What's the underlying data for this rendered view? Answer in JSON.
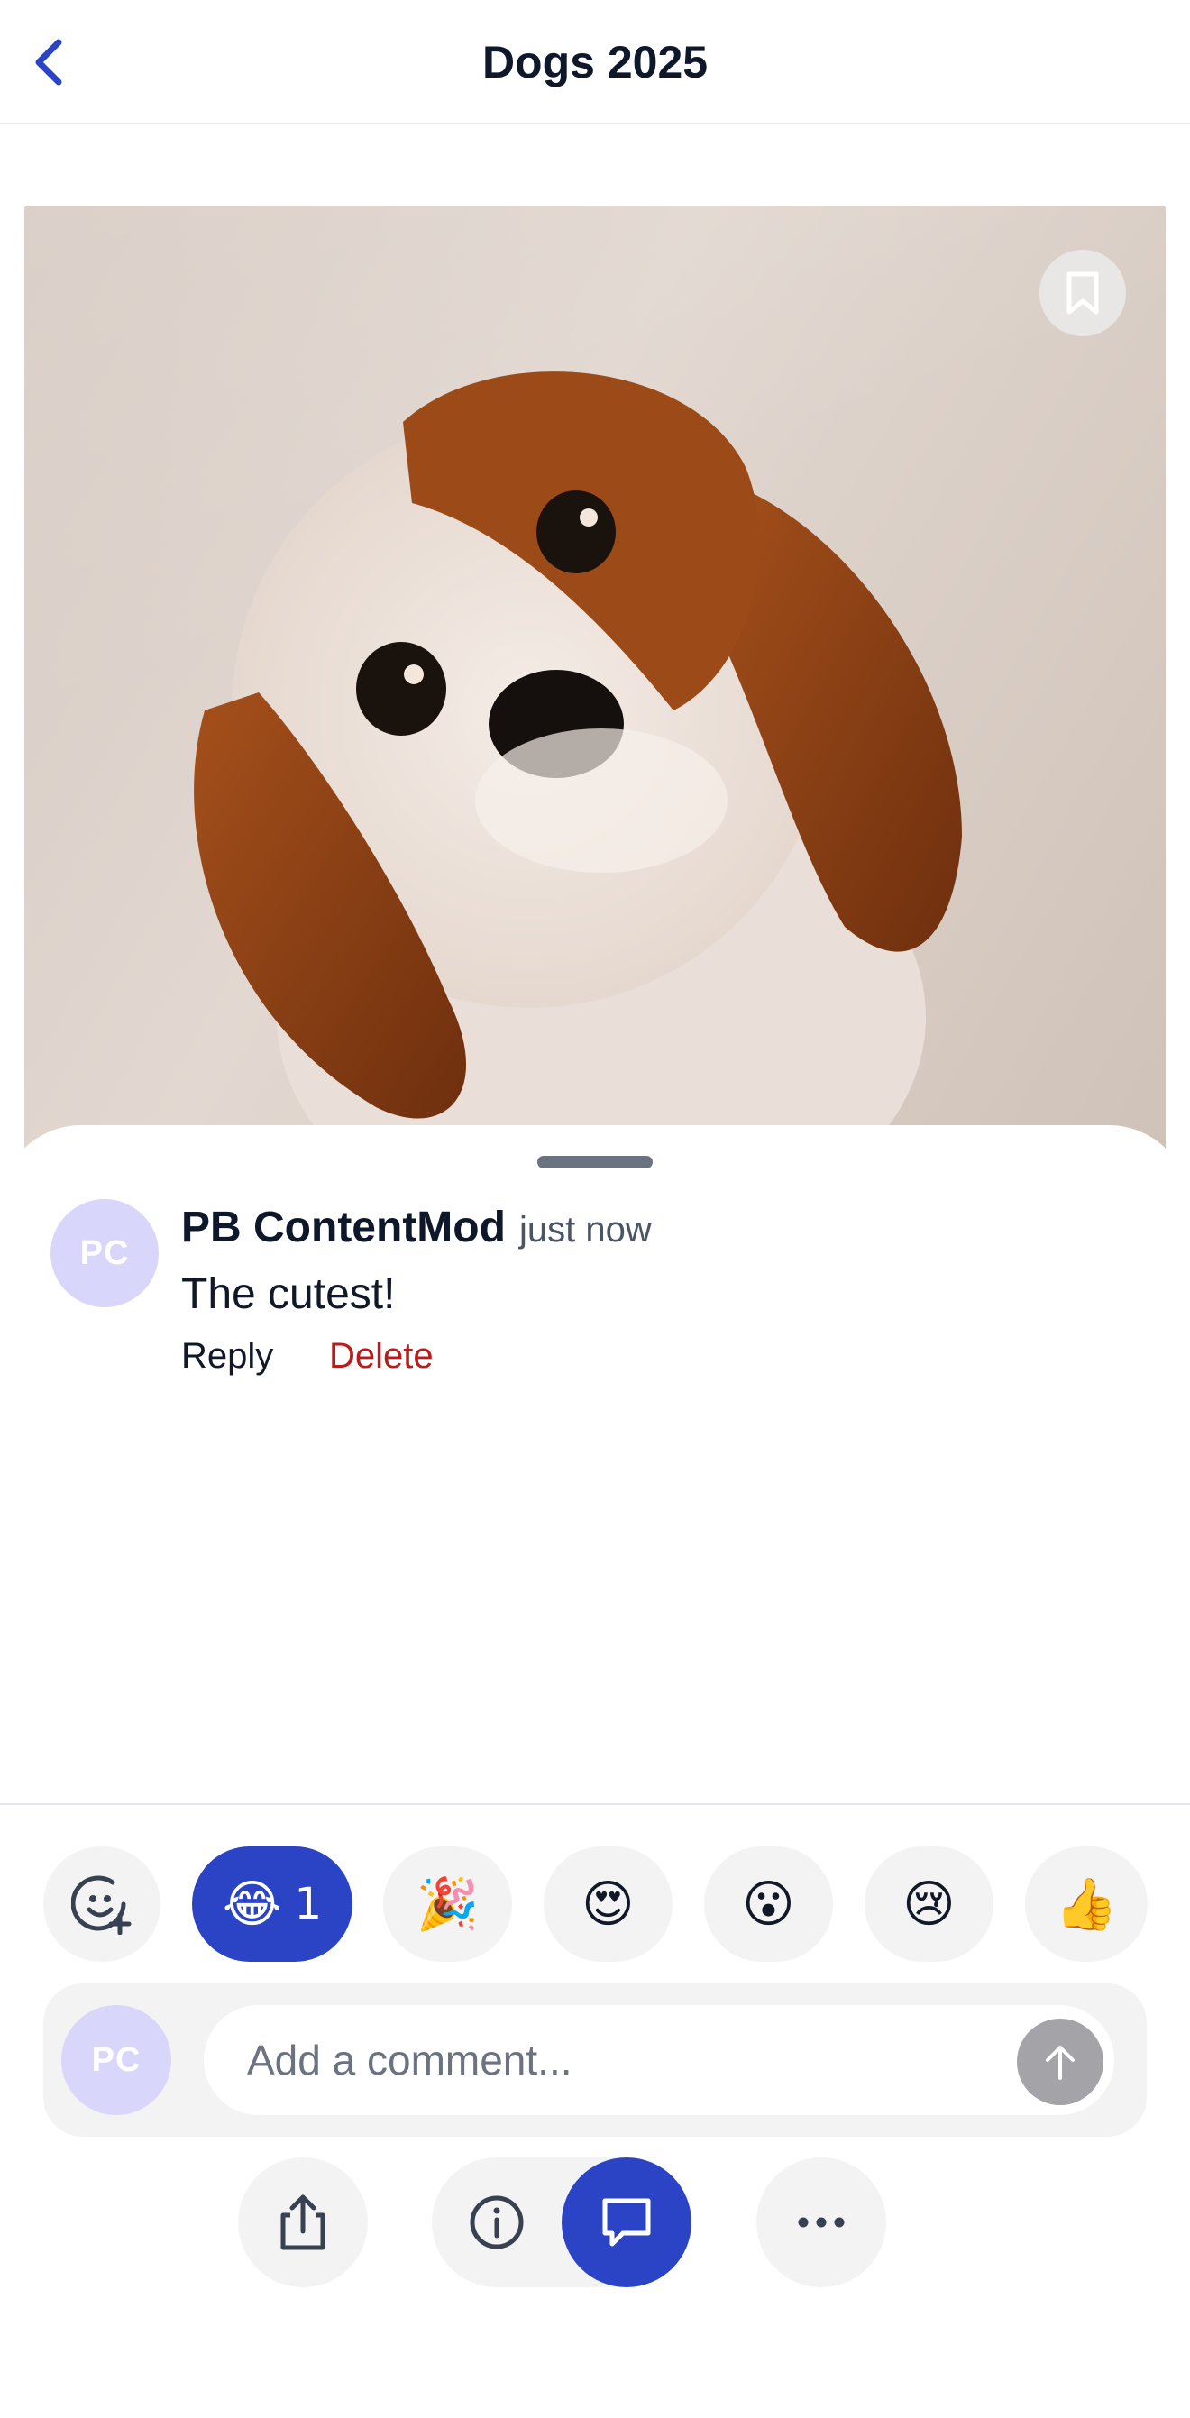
{
  "header": {
    "title": "Dogs 2025"
  },
  "comment": {
    "avatar_initials": "PC",
    "author": "PB ContentMod",
    "time": "just now",
    "text": "The cutest!",
    "reply_label": "Reply",
    "delete_label": "Delete"
  },
  "reactions": [
    {
      "icon": "add-reaction-icon"
    },
    {
      "emoji": "😂",
      "count": "1",
      "active": true
    },
    {
      "emoji": "🎉"
    },
    {
      "emoji": "😍"
    },
    {
      "emoji": "😮"
    },
    {
      "emoji": "😢"
    },
    {
      "emoji": "👍"
    }
  ],
  "composer": {
    "avatar_initials": "PC",
    "placeholder": "Add a comment..."
  },
  "toolbar": {
    "icons": [
      "share-icon",
      "info-icon",
      "comment-icon",
      "more-icon"
    ]
  },
  "colors": {
    "accent": "#2b44c6",
    "danger": "#b91c1c",
    "avatar_bg": "#d9d6fb"
  }
}
